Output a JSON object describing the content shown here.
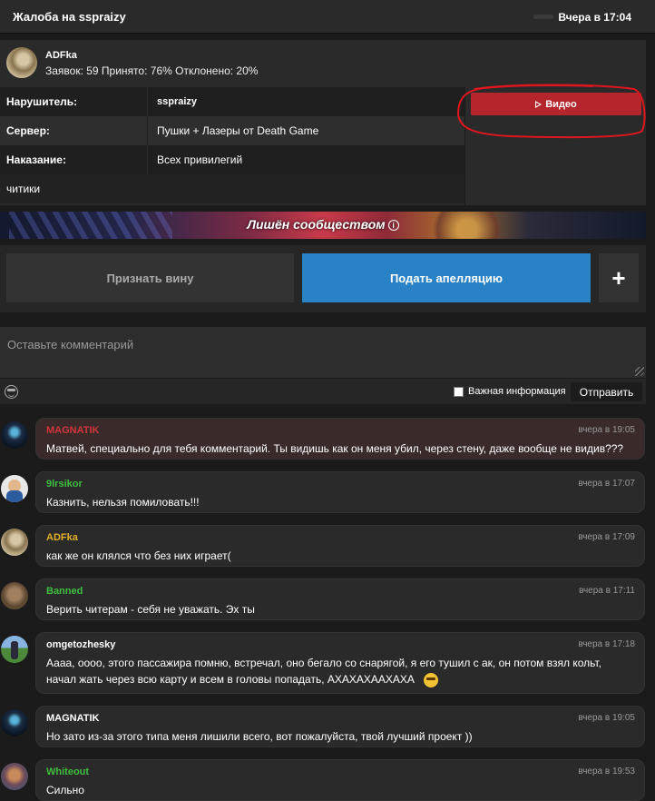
{
  "header": {
    "title": "Жалоба на sspraizy",
    "time": "Вчера в 17:04"
  },
  "complaint": {
    "author": "ADFka",
    "stats": "Заявок: 59 Принято: 76% Отклонено: 20%",
    "rows": [
      {
        "label": "Нарушитель:",
        "value": "sspraizy"
      },
      {
        "label": "Сервер:",
        "value": "Пушки + Лазеры от Death Game"
      },
      {
        "label": "Наказание:",
        "value": "Всех привилегий"
      }
    ],
    "description": "читики",
    "video_label": "Видео"
  },
  "banner": {
    "text": "Лишён сообществом",
    "info_icon": "i"
  },
  "actions": {
    "guilty": "Признать вину",
    "appeal": "Подать апелляцию",
    "plus": "+"
  },
  "comment_form": {
    "placeholder": "Оставьте комментарий",
    "important_label": "Важная информация",
    "send_label": "Отправить"
  },
  "comments": [
    {
      "author": "MAGNATIK",
      "color": "#d0363c",
      "time": "вчера в 19:05",
      "text": "Матвей, специально для тебя комментарий. Ты видишь как он меня убил, через стену, даже вообще не видив???",
      "highlight": true
    },
    {
      "author": "9lrsikor",
      "color": "#3fbf3f",
      "time": "вчера в 17:07",
      "text": "Казнить, нельзя помиловать!!!"
    },
    {
      "author": "ADFka",
      "color": "#e2b12a",
      "time": "вчера в 17:09",
      "text": "как же он клялся что без них играет("
    },
    {
      "author": "Banned",
      "color": "#3fbf3f",
      "time": "вчера в 17:11",
      "text": "Верить читерам - себя не уважать. Эх ты"
    },
    {
      "author": "omgetozhesky",
      "color": "#ffffff",
      "time": "вчера в 17:18",
      "text": "Аааа, оооо, этого пассажира помню, встречал, оно бегало со снарягой, я его тушил с ак, он потом взял кольт, начал жать через всю карту и всем в головы попадать, АХАХАХААХАХА"
    },
    {
      "author": "MAGNATIK",
      "color": "#ffffff",
      "time": "вчера в 19:05",
      "text": "Но зато из-за этого типа меня лишили всего, вот пожалуйста, твой лучший проект ))"
    },
    {
      "author": "Whiteout",
      "color": "#3fbf3f",
      "time": "вчера в 19:53",
      "text": "Сильно"
    }
  ],
  "colors": {
    "accent_blue": "#2a82c6",
    "accent_red": "#b5252c",
    "background": "#1b1b1b"
  }
}
